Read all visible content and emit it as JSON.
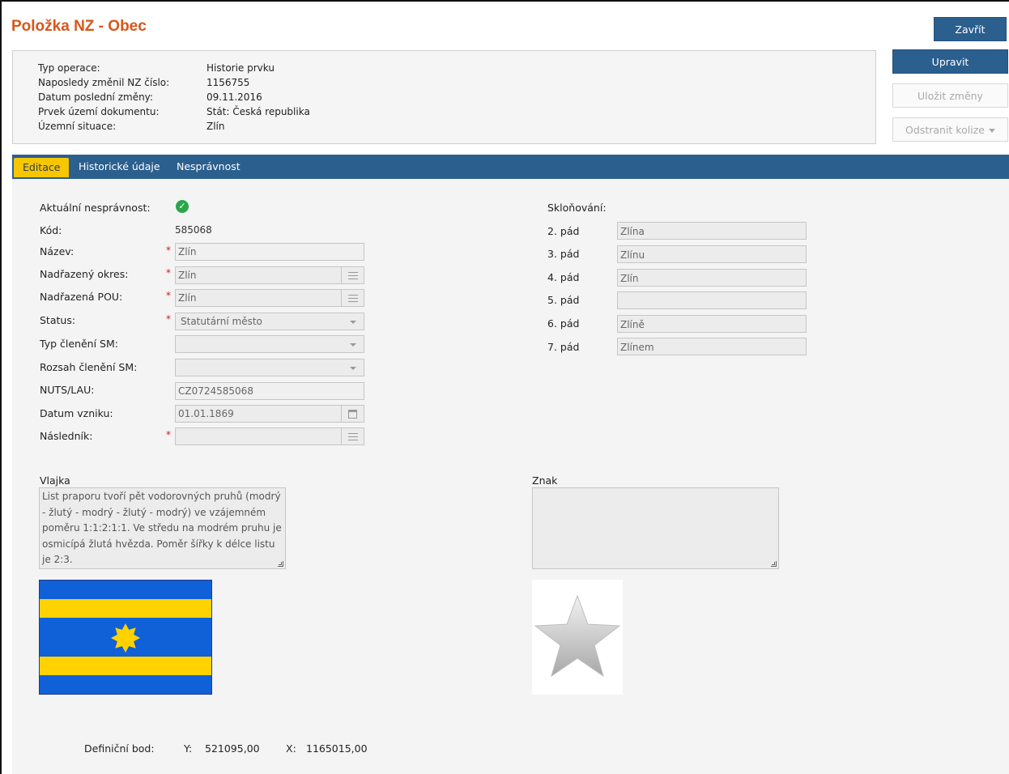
{
  "header": {
    "title": "Položka NZ - Obec",
    "buttons": {
      "close": "Zavřít",
      "edit": "Upravit",
      "save": "Uložit změny",
      "remove_conflicts": "Odstranit kolize"
    }
  },
  "info": [
    {
      "label": "Typ operace:",
      "value": "Historie prvku"
    },
    {
      "label": "Naposledy změnil NZ číslo:",
      "value": "1156755"
    },
    {
      "label": "Datum poslední změny:",
      "value": "09.11.2016"
    },
    {
      "label": "Prvek území dokumentu:",
      "value": "Stát: Česká republika"
    },
    {
      "label": "Územní situace:",
      "value": "Zlín"
    }
  ],
  "tabs": [
    {
      "label": "Editace",
      "active": true
    },
    {
      "label": "Historické údaje",
      "active": false
    },
    {
      "label": "Nesprávnost",
      "active": false
    }
  ],
  "form": {
    "current_error_label": "Aktuální nesprávnost:",
    "code_label": "Kód:",
    "code_value": "585068",
    "name_label": "Název:",
    "name_value": "Zlín",
    "district_label": "Nadřazený okres:",
    "district_value": "Zlín",
    "pou_label": "Nadřazená POU:",
    "pou_value": "Zlín",
    "status_label": "Status:",
    "status_value": "Statutární město",
    "sm_type_label": "Typ členění SM:",
    "sm_type_value": "",
    "sm_scope_label": "Rozsah členění SM:",
    "sm_scope_value": "",
    "nuts_label": "NUTS/LAU:",
    "nuts_value": "CZ0724585068",
    "founded_label": "Datum vzniku:",
    "founded_value": "01.01.1869",
    "successor_label": "Následník:",
    "successor_value": "",
    "required_mark": "*"
  },
  "declension": {
    "title": "Skloňování:",
    "cases": [
      {
        "label": "2. pád",
        "value": "Zlína"
      },
      {
        "label": "3. pád",
        "value": "Zlínu"
      },
      {
        "label": "4. pád",
        "value": "Zlín"
      },
      {
        "label": "5. pád",
        "value": ""
      },
      {
        "label": "6. pád",
        "value": "Zlíně"
      },
      {
        "label": "7. pád",
        "value": "Zlínem"
      }
    ]
  },
  "flag": {
    "label": "Vlajka",
    "description": "List praporu tvoří pět vodorovných pruhů (modrý - žlutý - modrý - žlutý - modrý) ve vzájemném poměru 1:1:2:1:1. Ve středu na modrém pruhu je osmicípá žlutá hvězda. Poměr šířky k délce listu je 2:3.",
    "colors": {
      "blue": "#1060d8",
      "yellow": "#ffd200"
    }
  },
  "emblem": {
    "label": "Znak",
    "description": ""
  },
  "definition_point": {
    "label": "Definiční bod:",
    "y_label": "Y:",
    "y_value": "521095,00",
    "x_label": "X:",
    "x_value": "1165015,00"
  },
  "colors": {
    "title": "#d8561b",
    "primary": "#2b5f8e",
    "active_tab": "#f7c600",
    "success": "#2ba64a"
  },
  "icons": [
    "check-circle-icon",
    "list-icon",
    "calendar-icon",
    "chevron-down-icon",
    "star-placeholder-icon"
  ]
}
